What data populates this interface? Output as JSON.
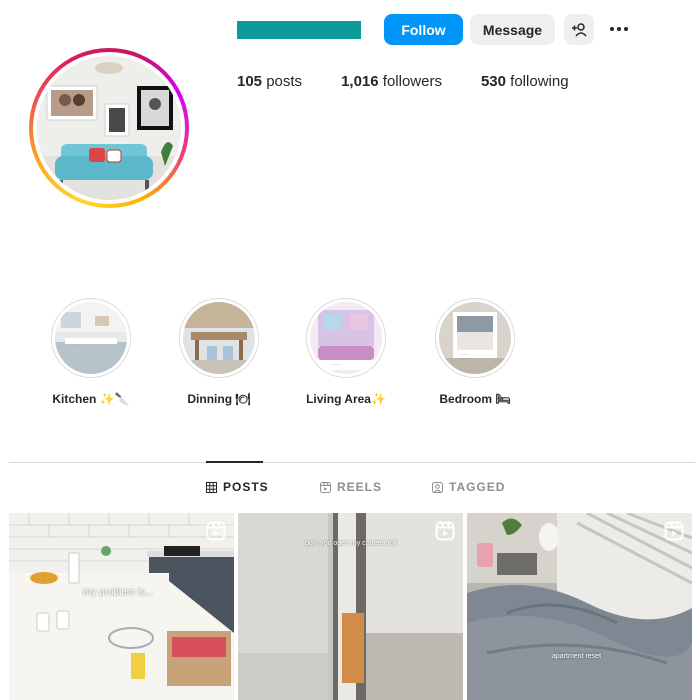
{
  "profile": {
    "follow_label": "Follow",
    "message_label": "Message",
    "stats": {
      "posts_count": "105",
      "posts_label": "posts",
      "followers_count": "1,016",
      "followers_label": "followers",
      "following_count": "530",
      "following_label": "following"
    },
    "accent_color": "#0095f6",
    "username_bar_color": "#0f9a9a"
  },
  "highlights": [
    {
      "label": "Kitchen ✨🔪"
    },
    {
      "label": "Dinning 🍽"
    },
    {
      "label": "Living Area✨"
    },
    {
      "label": "Bedroom 🛏"
    }
  ],
  "tabs": [
    {
      "label": "POSTS",
      "icon": "grid-icon",
      "active": true
    },
    {
      "label": "REELS",
      "icon": "reels-icon",
      "active": false
    },
    {
      "label": "TAGGED",
      "icon": "tagged-icon",
      "active": false
    }
  ],
  "posts": [
    {
      "caption": "my problem is...",
      "icon": "reel-icon"
    },
    {
      "caption": "pov: you open my camera roll",
      "icon": "reel-icon"
    },
    {
      "caption": "apartment reset",
      "icon": "reel-icon"
    }
  ]
}
